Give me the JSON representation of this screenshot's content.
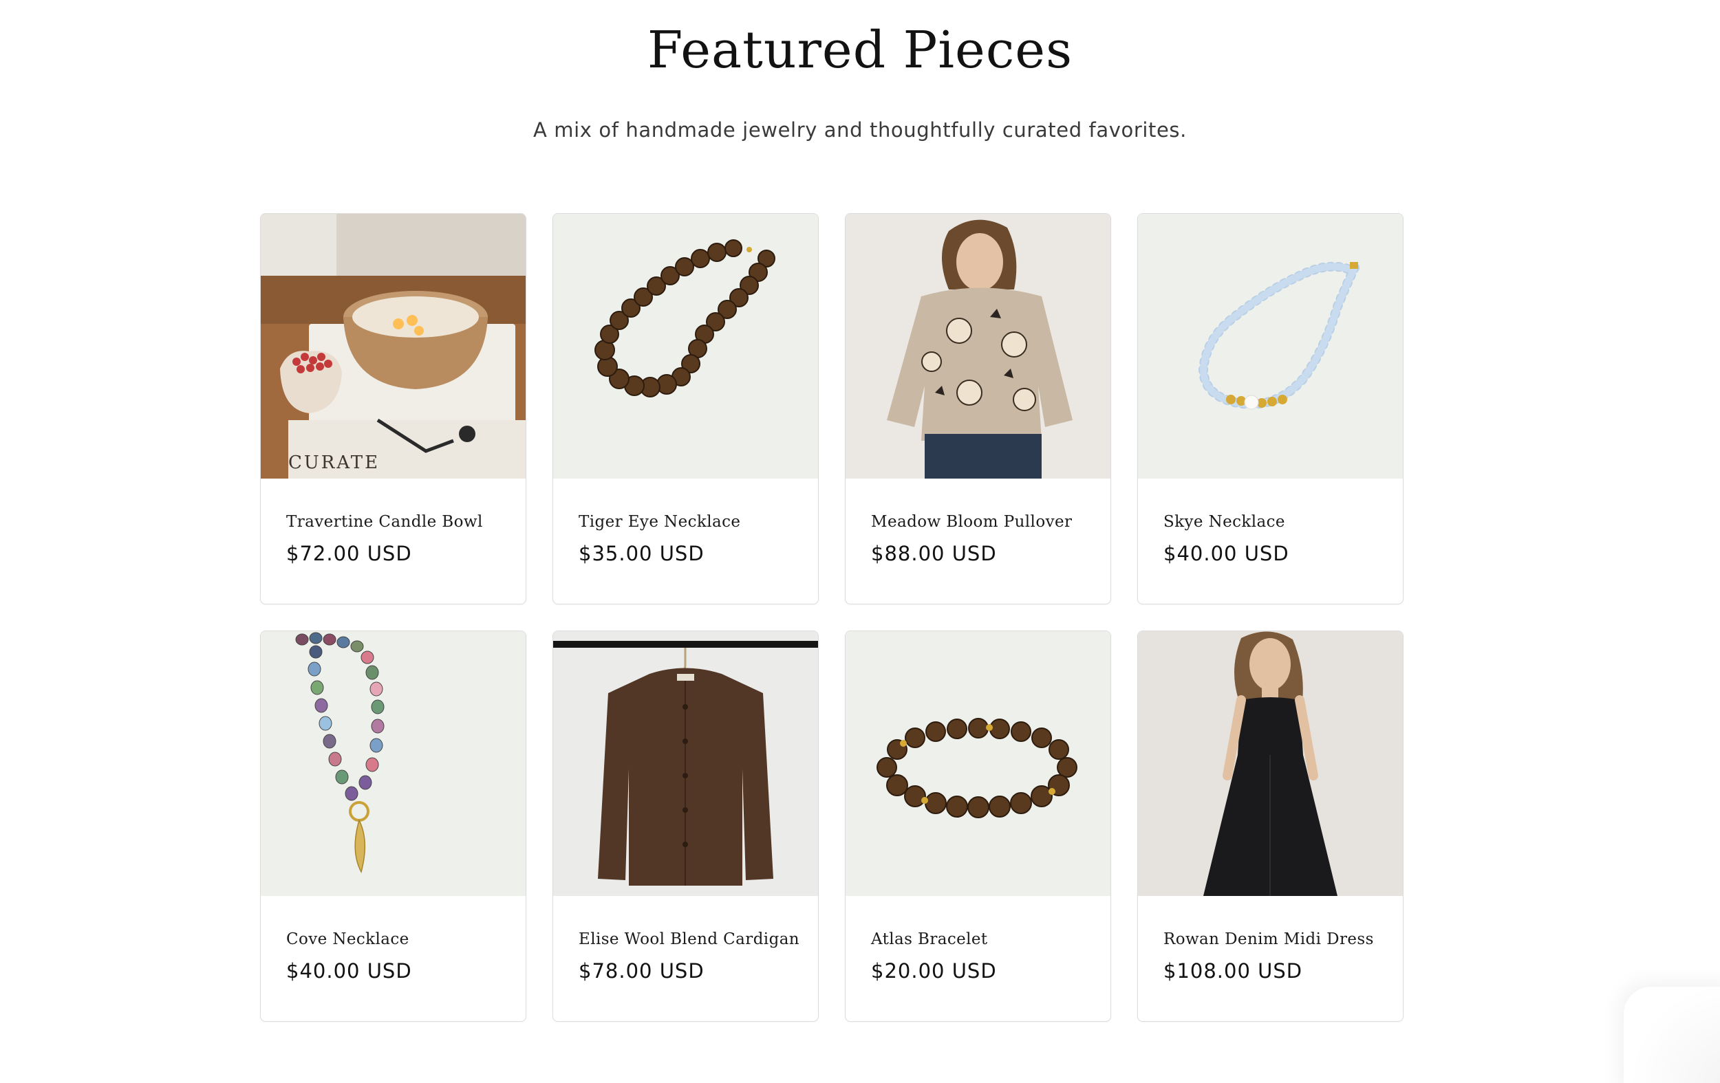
{
  "section": {
    "title": "Featured Pieces",
    "subtitle": "A mix of handmade jewelry and thoughtfully curated favorites."
  },
  "products": [
    {
      "title": "Travertine Candle Bowl",
      "price": "$72.00 USD",
      "image": "candle-bowl-photo"
    },
    {
      "title": "Tiger Eye Necklace",
      "price": "$35.00 USD",
      "image": "tiger-eye-necklace-photo"
    },
    {
      "title": "Meadow Bloom Pullover",
      "price": "$88.00 USD",
      "image": "floral-pullover-photo"
    },
    {
      "title": "Skye Necklace",
      "price": "$40.00 USD",
      "image": "blue-bead-necklace-photo"
    },
    {
      "title": "Cove Necklace",
      "price": "$40.00 USD",
      "image": "multicolor-bead-necklace-photo"
    },
    {
      "title": "Elise Wool Blend Cardigan",
      "price": "$78.00 USD",
      "image": "brown-cardigan-photo"
    },
    {
      "title": "Atlas Bracelet",
      "price": "$20.00 USD",
      "image": "tiger-eye-bracelet-photo"
    },
    {
      "title": "Rowan Denim Midi Dress",
      "price": "$108.00 USD",
      "image": "black-midi-dress-photo"
    }
  ],
  "text_words": {
    "candle_book": "CURATE"
  },
  "colors": {
    "background": "#ffffff",
    "card_border": "#dcdcdc",
    "text": "#121212",
    "subtitle": "#3a3a3a"
  }
}
